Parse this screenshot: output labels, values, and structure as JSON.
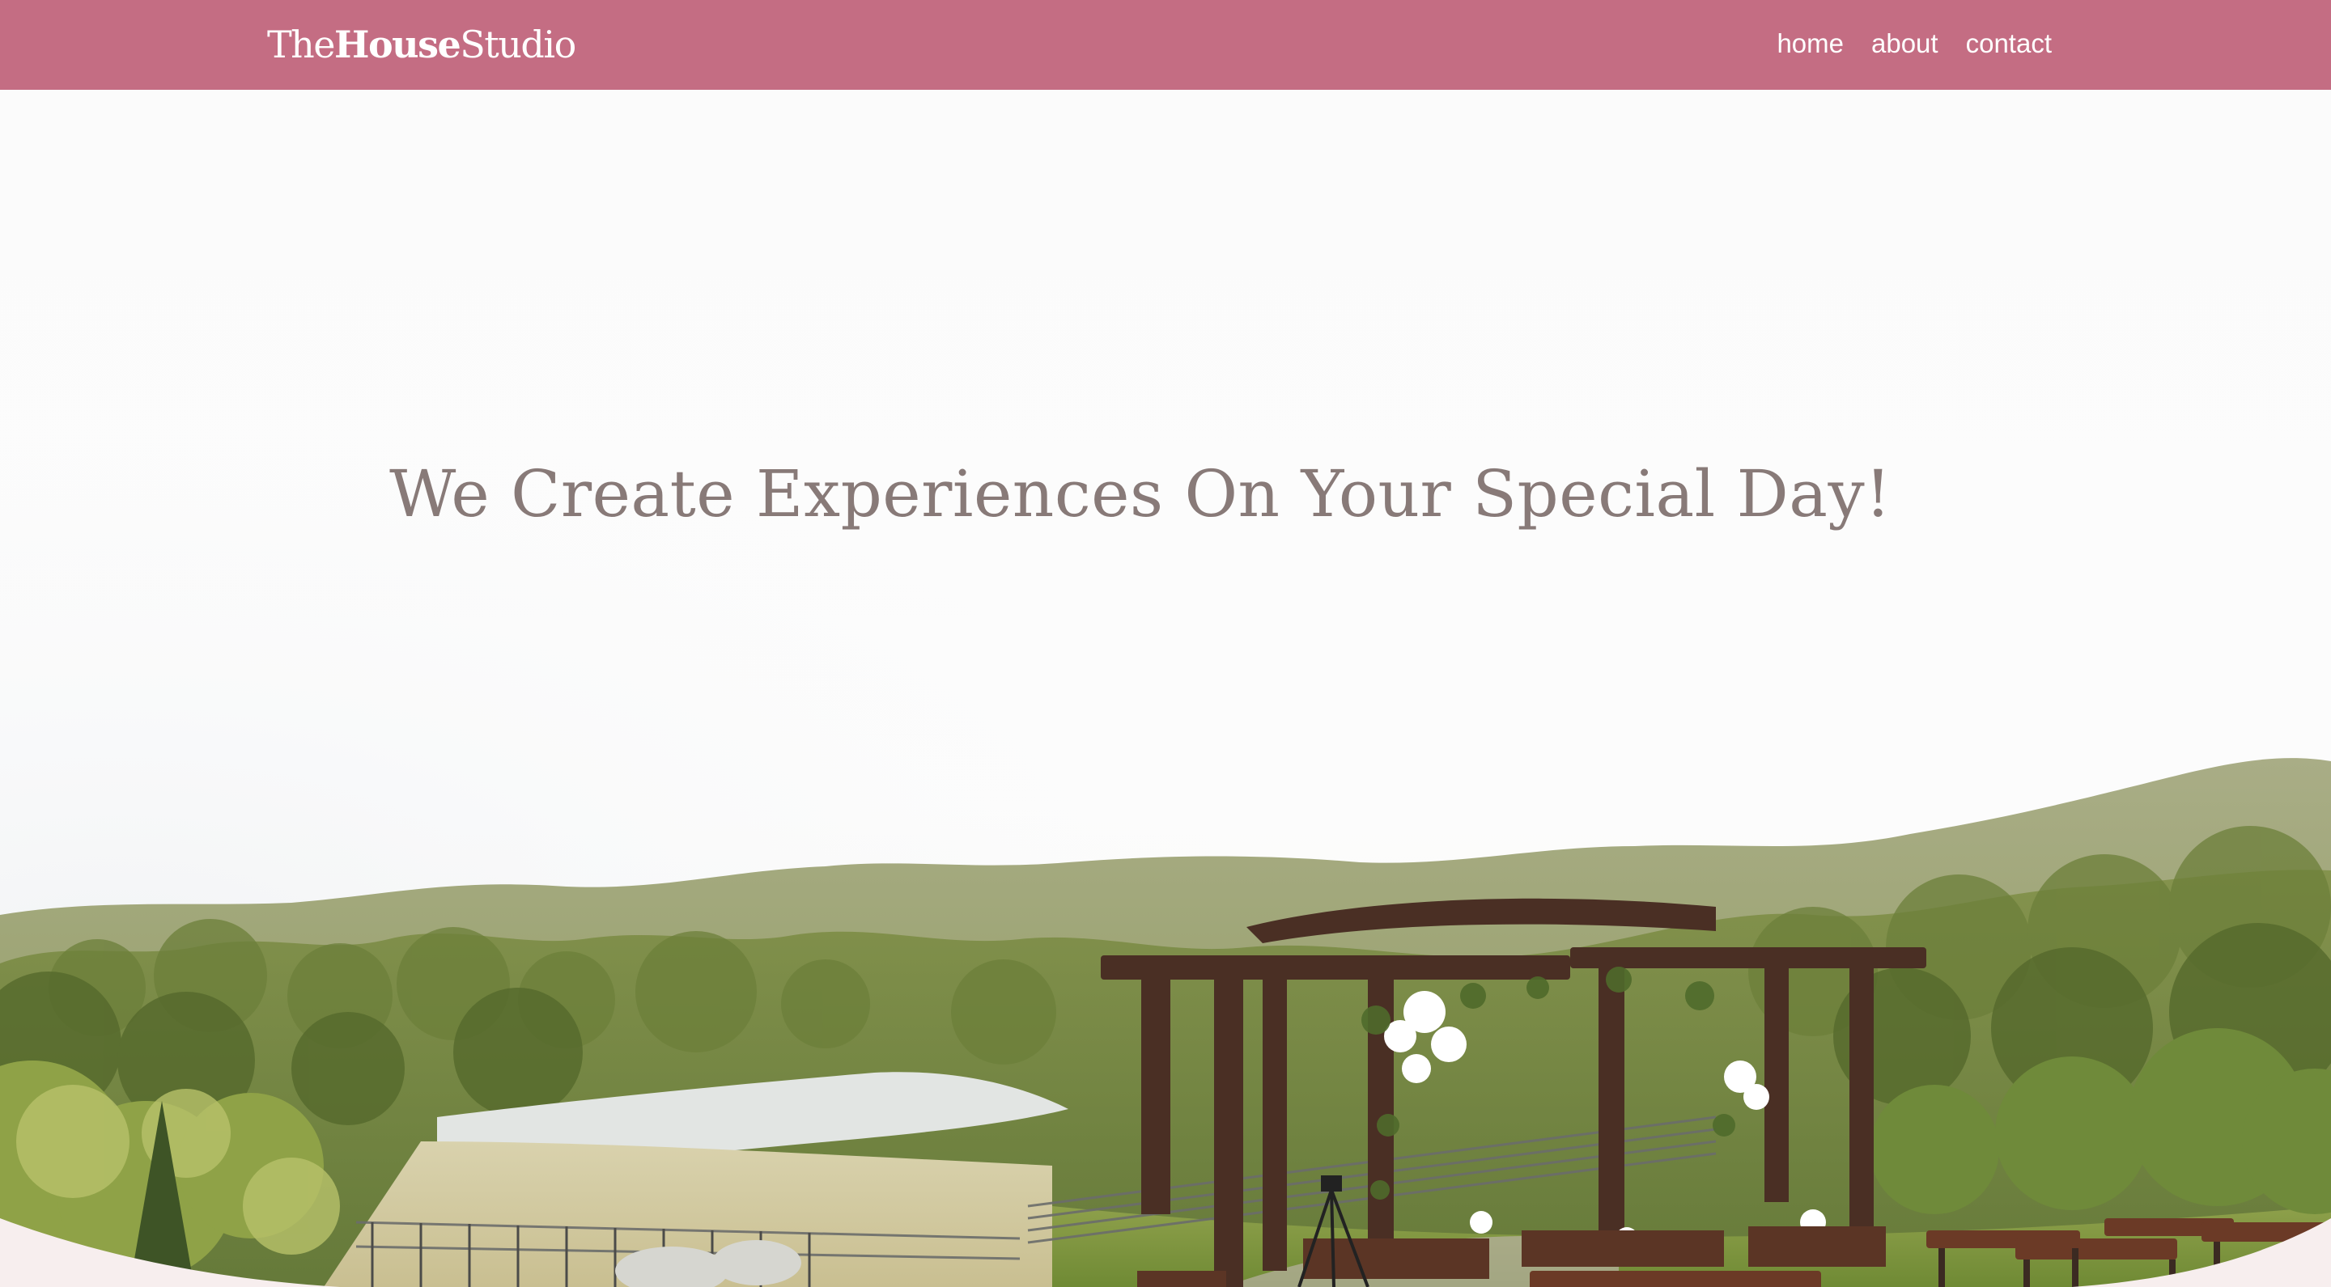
{
  "header": {
    "logo": {
      "part1": "The",
      "part2": "House",
      "part3": "Studio"
    },
    "nav": [
      {
        "label": "home"
      },
      {
        "label": "about"
      },
      {
        "label": "contact"
      }
    ]
  },
  "hero": {
    "heading": "We Create Experiences On Your Special Day!",
    "image": "outdoor wedding ceremony venue with wooden pergola, flowers and benches overlooking green hills"
  },
  "colors": {
    "header_bg": "#c46d83",
    "header_text": "#ffffff",
    "heading_text": "#887a78",
    "wave": "#f7eeee"
  }
}
